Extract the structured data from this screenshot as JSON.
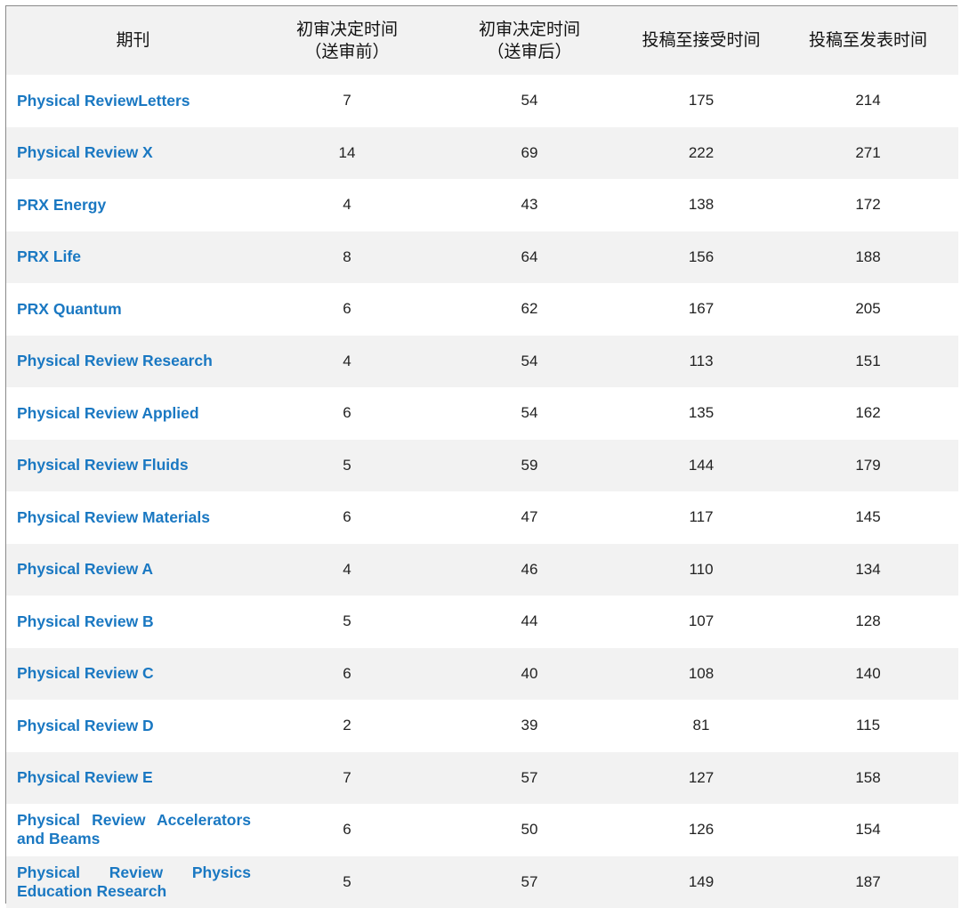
{
  "table": {
    "headers": [
      {
        "lines": [
          "期刊"
        ]
      },
      {
        "lines": [
          "初审决定时间",
          "（送审前）"
        ]
      },
      {
        "lines": [
          "初审决定时间",
          "（送审后）"
        ]
      },
      {
        "lines": [
          "投稿至接受时间"
        ]
      },
      {
        "lines": [
          "投稿至发表时间"
        ]
      }
    ],
    "rows": [
      {
        "journal": "Physical ReviewLetters",
        "before": "7",
        "after": "54",
        "accept": "175",
        "publish": "214"
      },
      {
        "journal": "Physical Review X",
        "before": "14",
        "after": "69",
        "accept": "222",
        "publish": "271"
      },
      {
        "journal": "PRX Energy",
        "before": "4",
        "after": "43",
        "accept": "138",
        "publish": "172"
      },
      {
        "journal": "PRX Life",
        "before": "8",
        "after": "64",
        "accept": "156",
        "publish": "188"
      },
      {
        "journal": "PRX Quantum",
        "before": "6",
        "after": "62",
        "accept": "167",
        "publish": "205"
      },
      {
        "journal": "Physical Review Research",
        "before": "4",
        "after": "54",
        "accept": "113",
        "publish": "151"
      },
      {
        "journal": "Physical Review Applied",
        "before": "6",
        "after": "54",
        "accept": "135",
        "publish": "162"
      },
      {
        "journal": "Physical Review Fluids",
        "before": "5",
        "after": "59",
        "accept": "144",
        "publish": "179"
      },
      {
        "journal": "Physical Review Materials",
        "before": "6",
        "after": "47",
        "accept": "117",
        "publish": "145"
      },
      {
        "journal": "Physical Review A",
        "before": "4",
        "after": "46",
        "accept": "110",
        "publish": "134"
      },
      {
        "journal": "Physical Review B",
        "before": "5",
        "after": "44",
        "accept": "107",
        "publish": "128"
      },
      {
        "journal": "Physical Review C",
        "before": "6",
        "after": "40",
        "accept": "108",
        "publish": "140"
      },
      {
        "journal": "Physical Review D",
        "before": "2",
        "after": "39",
        "accept": "81",
        "publish": "115"
      },
      {
        "journal": "Physical Review E",
        "before": "7",
        "after": "57",
        "accept": "127",
        "publish": "158"
      },
      {
        "journal": "Physical Review Accelerators and Beams",
        "before": "6",
        "after": "50",
        "accept": "126",
        "publish": "154"
      },
      {
        "journal": "Physical Review Physics Education Research",
        "before": "5",
        "after": "57",
        "accept": "149",
        "publish": "187"
      }
    ]
  },
  "colors": {
    "link": "#1a78c2",
    "stripe": "#f2f2f2",
    "border": "#8a8a8a"
  }
}
